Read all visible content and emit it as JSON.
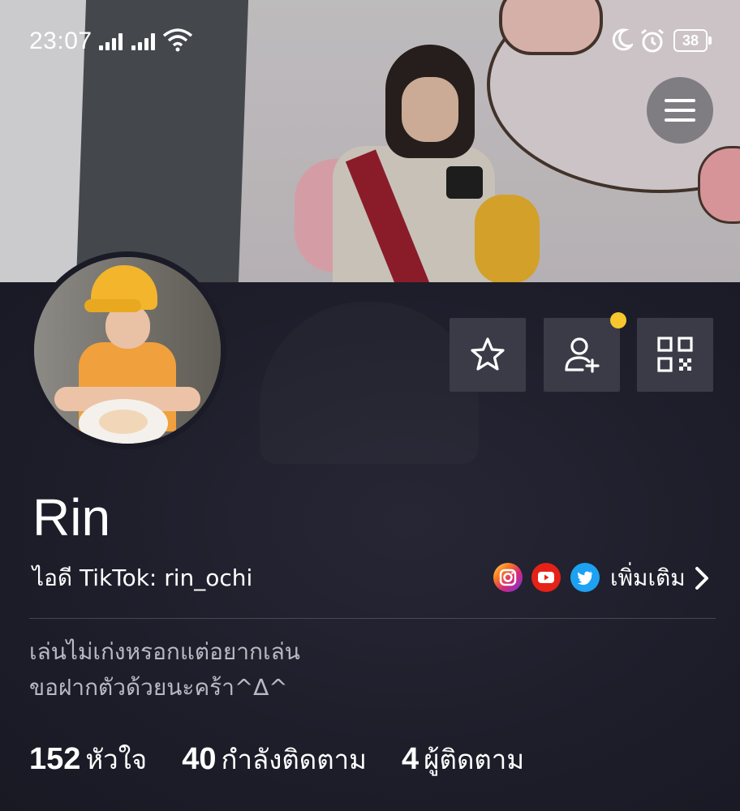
{
  "status_bar": {
    "time": "23:07",
    "battery": "38",
    "icons": [
      "signal-icon",
      "signal-icon",
      "wifi-icon",
      "moon-icon",
      "alarm-icon",
      "battery-icon"
    ]
  },
  "profile": {
    "name": "Rin",
    "tiktok_id": "ไอดี TikTok: rin_ochi",
    "more_link": "เพิ่มเติม",
    "bio_line1": "เล่นไม่เก่งหรอกแต่อยากเล่น",
    "bio_line2": "ขอฝากตัวด้วยนะคร้า^∆^",
    "social_icons": [
      "instagram-icon",
      "youtube-icon",
      "twitter-icon"
    ]
  },
  "actions": [
    "star-icon",
    "add-friend-icon",
    "qr-code-icon"
  ],
  "colors": {
    "background": "#1b1b27",
    "button_bg": "#3b3b48",
    "notification_dot": "#f7c72d",
    "youtube": "#e62117",
    "twitter": "#1da1f2",
    "instagram": "#c13584"
  },
  "stats": [
    {
      "value": "152",
      "label": "หัวใจ"
    },
    {
      "value": "40",
      "label": "กำลังติดตาม"
    },
    {
      "value": "4",
      "label": "ผู้ติดตาม"
    }
  ]
}
